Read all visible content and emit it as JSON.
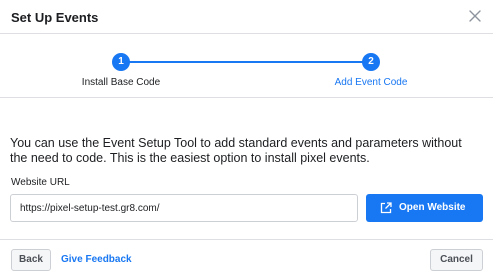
{
  "dialog": {
    "title": "Set Up Events",
    "close_icon": "close-icon"
  },
  "stepper": {
    "steps": [
      {
        "number": "1",
        "label": "Install Base Code",
        "state": "complete"
      },
      {
        "number": "2",
        "label": "Add Event Code",
        "state": "active"
      }
    ]
  },
  "body": {
    "description": "You can use the Event Setup Tool to add standard events and parameters without the need to code. This is the easiest option to install pixel events.",
    "url_label": "Website URL",
    "url_value": "https://pixel-setup-test.gr8.com/",
    "open_button": {
      "label": "Open Website",
      "icon": "external-link-icon"
    }
  },
  "footer": {
    "back_label": "Back",
    "feedback_label": "Give Feedback",
    "cancel_label": "Cancel"
  },
  "colors": {
    "accent": "#1877f2",
    "text": "#1c1e21",
    "border": "#dddfe2",
    "label_secondary": "#4b4f56"
  }
}
